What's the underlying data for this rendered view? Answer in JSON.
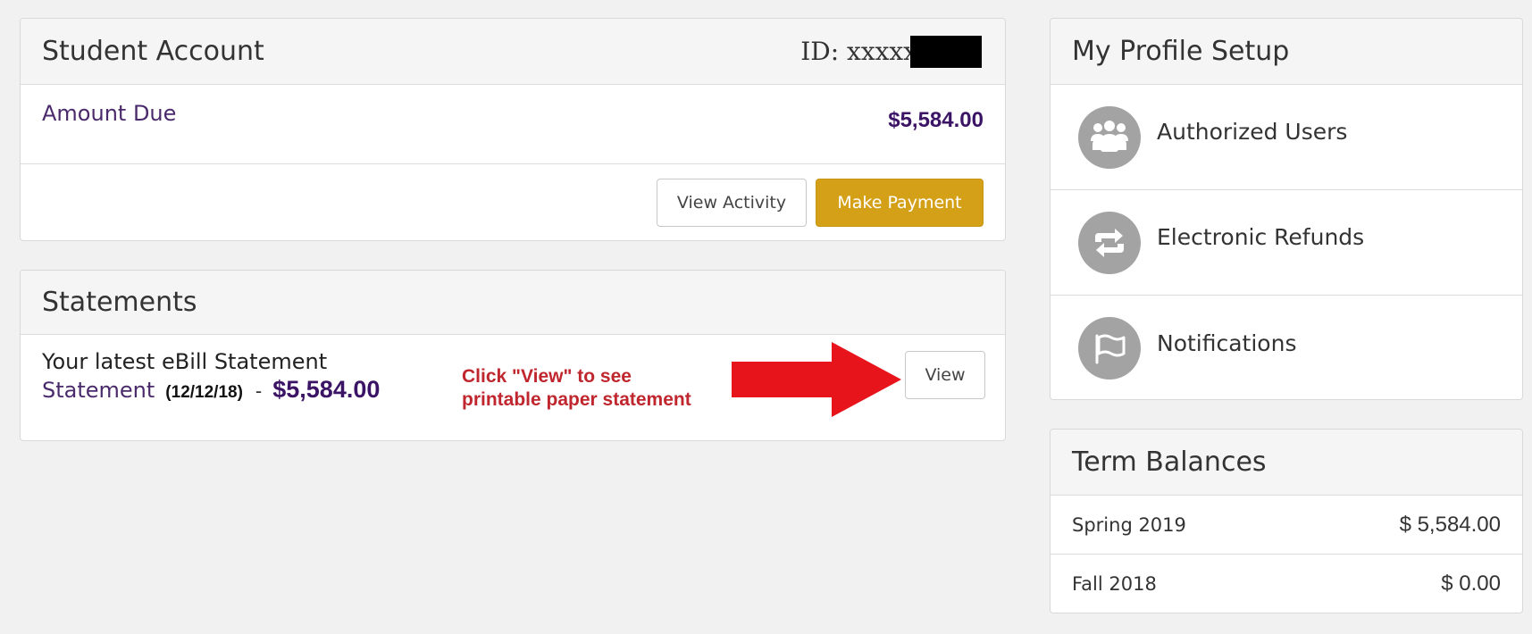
{
  "student_account": {
    "title": "Student Account",
    "id_label": "ID: xxxxx",
    "amount_due_label": "Amount Due",
    "amount_due_value": "$5,584.00",
    "view_activity_label": "View Activity",
    "make_payment_label": "Make Payment"
  },
  "statements": {
    "title": "Statements",
    "latest_label": "Your latest eBill Statement",
    "statement_link": "Statement",
    "statement_date": "(12/12/18)",
    "separator": "-",
    "statement_amount": "$5,584.00",
    "annotation_line1": "Click \"View\" to see",
    "annotation_line2": "printable paper statement",
    "view_label": "View"
  },
  "profile_setup": {
    "title": "My Profile Setup",
    "items": [
      {
        "label": "Authorized Users",
        "icon": "users-icon"
      },
      {
        "label": "Electronic Refunds",
        "icon": "refresh-icon"
      },
      {
        "label": "Notifications",
        "icon": "flag-icon"
      }
    ]
  },
  "term_balances": {
    "title": "Term Balances",
    "rows": [
      {
        "term": "Spring 2019",
        "amount": "$ 5,584.00"
      },
      {
        "term": "Fall 2018",
        "amount": "$ 0.00"
      }
    ]
  },
  "colors": {
    "accent_purple": "#3c1466",
    "button_gold": "#d4a017",
    "annotation_red": "#c0262d",
    "icon_gray": "#a3a3a3"
  }
}
